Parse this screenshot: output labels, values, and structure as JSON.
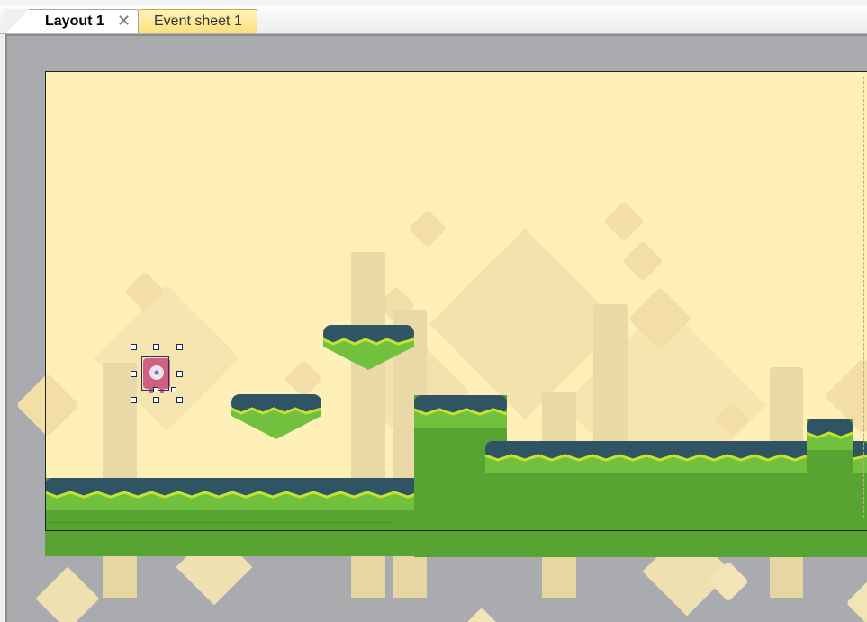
{
  "tabs": [
    {
      "label": "Layout 1",
      "active": true,
      "closable": true,
      "close_icon": "close-icon"
    },
    {
      "label": "Event sheet 1",
      "active": false
    }
  ],
  "colors": {
    "background_pale": "#fff0b8",
    "background_shape": "#f4e2ac",
    "pillar": "#ead9a6",
    "ground": "#57a432",
    "ground_light": "#72c13e",
    "grass_stripe": "#c6e231",
    "platform_cap": "#2f5565",
    "player": "#d0607e",
    "viewport_gray": "#a9abae",
    "event_tab": "#fde07a"
  },
  "scene": {
    "objects": [
      {
        "kind": "player-sprite",
        "selected": true
      },
      {
        "kind": "floating-platform"
      },
      {
        "kind": "floating-platform"
      },
      {
        "kind": "ground-tile"
      },
      {
        "kind": "ground-tile"
      },
      {
        "kind": "ground-tile"
      },
      {
        "kind": "ground-tile"
      }
    ]
  }
}
